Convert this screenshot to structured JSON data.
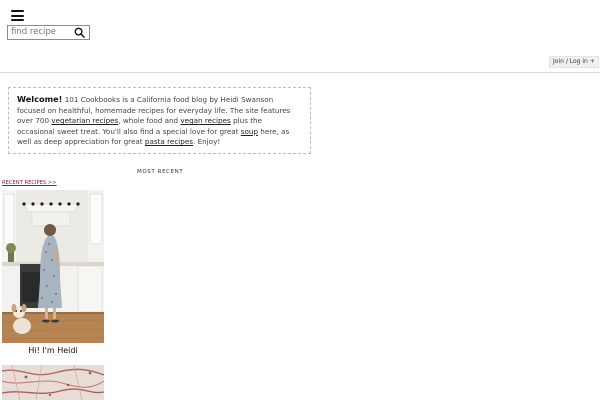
{
  "header": {
    "menu_icon": "hamburger-menu-icon",
    "search": {
      "placeholder": "find recipe",
      "icon": "search-icon"
    },
    "join_login": "Join / Log in +"
  },
  "welcome": {
    "lead": "Welcome!",
    "text_1": " 101 Cookbooks is a California food blog by Heidi Swanson focused on healthful, homemade recipes for everyday life. The site features over 700 ",
    "link_vegetarian": "vegetarian recipes",
    "text_2": ", whole food and ",
    "link_vegan": "vegan recipes",
    "text_3": " plus the occasional sweet treat. You'll also find a special love for great ",
    "link_soup": "soup",
    "text_4": " here, as well as deep appreciation for great ",
    "link_pasta": "pasta recipes",
    "text_5": ". Enjoy!"
  },
  "most_recent": {
    "heading": "MOST RECENT",
    "recent_link": "RECENT RECIPES >>"
  },
  "cards": [
    {
      "caption": "Hi! I'm Heidi"
    }
  ],
  "colors": {
    "accent_link": "#8b1f2b",
    "border": "#bdbdbd",
    "divider": "#d9d9d9"
  }
}
